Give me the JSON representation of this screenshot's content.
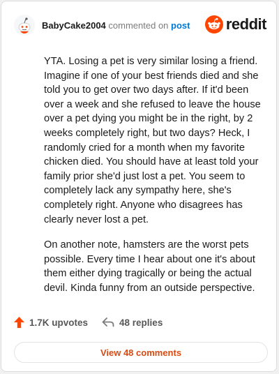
{
  "comment": {
    "username": "BabyCake2004",
    "commented_on_text": "commented on",
    "post_link": "post",
    "paragraphs": [
      "YTA. Losing a pet is very similar losing a friend. Imagine if one of your best friends died and she told you to get over two days after. If it'd been over a week and she refused to leave the house over a pet dying you might be in the right, by 2 weeks completely right, but two days? Heck, I randomly cried for a month when my favorite chicken died. You should have at least told your family prior she'd just lost a pet. You seem to completely lack any sympathy here, she's completely right. Anyone who disagrees has clearly never lost a pet.",
      "On another note, hamsters are the worst pets possible. Every time I hear about one it's about them either dying tragically or being the actual devil. Kinda funny from an outside perspective."
    ]
  },
  "brand": {
    "name": "reddit",
    "icon": "reddit-logo-icon",
    "color": "#ff4500"
  },
  "actions": {
    "upvotes": "1.7K upvotes",
    "replies": "48 replies",
    "upvote_icon": "upvote-arrow-icon",
    "reply_icon": "reply-arrow-icon",
    "upvote_color": "#ff4500"
  },
  "view_button": {
    "label": "View 48 comments",
    "color": "#d84a12"
  }
}
